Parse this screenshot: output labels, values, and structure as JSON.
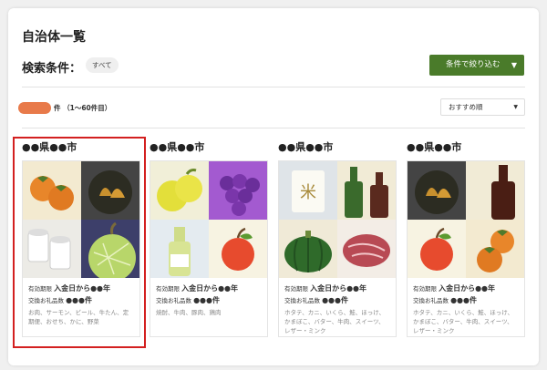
{
  "page": {
    "title": "自治体一覧",
    "conditions_label": "検索条件：",
    "condition_chip": "すべて",
    "filter_button": "条件で絞り込む",
    "result_range": "件 （1〜60件目）",
    "sort_value": "おすすめ順"
  },
  "colors": {
    "accent_green": "#4a7b2a",
    "count_pill": "#e87a4a",
    "highlight": "#d32020"
  },
  "cards": [
    {
      "title": "●●県●●市",
      "expiry_label": "有効期限",
      "expiry_value": "入金日から●●年",
      "count_label": "交換お礼品数",
      "count_value": "●●●件",
      "items": "お肉、サーモン、ビール、牛たん、定期便、おせち、かに、野菜",
      "tiles": [
        "persimmon-icon",
        "chestnut-icon",
        "toilet-paper-icon",
        "melon-icon"
      ]
    },
    {
      "title": "●●県●●市",
      "expiry_label": "有効期限",
      "expiry_value": "入金日から●●年",
      "count_label": "交換お礼品数",
      "count_value": "●●●件",
      "items": "焼酎、牛肉、豚肉、鶏肉",
      "tiles": [
        "pear-icon",
        "grape-icon",
        "wine-bottle-icon",
        "apple-icon"
      ]
    },
    {
      "title": "●●県●●市",
      "expiry_label": "有効期限",
      "expiry_value": "入金日から●●年",
      "count_label": "交換お礼品数",
      "count_value": "●●●件",
      "items": "ホタテ、カニ、いくら、鮭、ほっけ、かまぼこ、バター、牛肉、スイーツ、レザー・ミンク",
      "tiles": [
        "rice-bag-icon",
        "wine-bottles-icon",
        "pumpkin-icon",
        "beef-icon"
      ]
    },
    {
      "title": "●●県●●市",
      "expiry_label": "有効期限",
      "expiry_value": "入金日から●●年",
      "count_label": "交換お礼品数",
      "count_value": "●●●件",
      "items": "ホタテ、カニ、いくら、鮭、ほっけ、かまぼこ、バター、牛肉、スイーツ、レザー・ミンク",
      "tiles": [
        "chestnut-icon",
        "wine-bottle-icon",
        "apple-icon",
        "persimmon-icon"
      ]
    }
  ]
}
